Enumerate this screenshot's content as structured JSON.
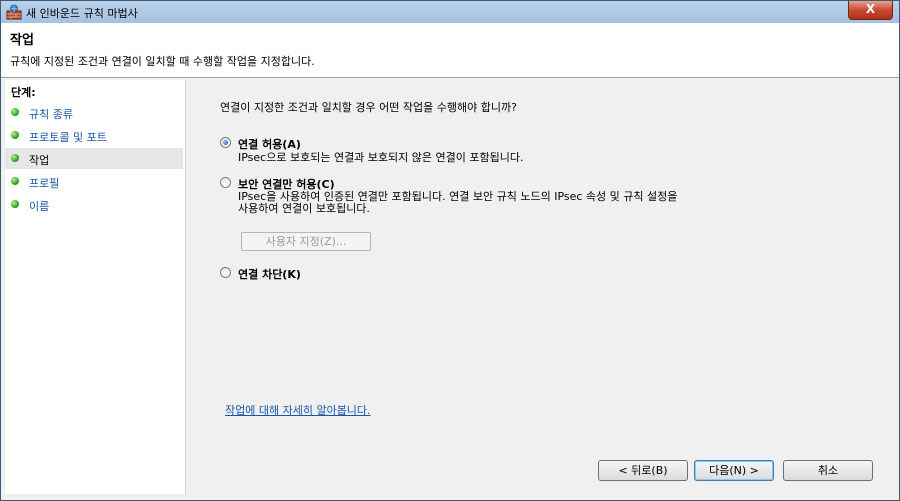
{
  "window": {
    "title": "새 인바운드 규칙 마법사",
    "close_label": "X"
  },
  "header": {
    "title": "작업",
    "description": "규칙에 지정된 조건과 연결이 일치할 때 수행할 작업을 지정합니다."
  },
  "sidebar": {
    "steps_label": "단계:",
    "items": [
      {
        "label": "규칙 종류"
      },
      {
        "label": "프로토콜 및 포트"
      },
      {
        "label": "작업"
      },
      {
        "label": "프로필"
      },
      {
        "label": "이름"
      }
    ],
    "current_index": 2
  },
  "main": {
    "question": "연결이 지정한 조건과 일치할 경우 어떤 작업을 수행해야 합니까?",
    "options": [
      {
        "label": "연결 허용(A)",
        "desc": "IPsec으로 보호되는 연결과 보호되지 않은 연결이 포함됩니다.",
        "checked": true
      },
      {
        "label": "보안 연결만 허용(C)",
        "desc_line1": "IPsec을 사용하여 인증된 연결만 포함됩니다. 연결 보안 규칙 노드의 IPsec 속성 및 규칙 설정을",
        "desc_line2": "사용하여 연결이 보호됩니다.",
        "checked": false
      },
      {
        "label": "연결 차단(K)",
        "checked": false
      }
    ],
    "custom_button": "사용자 지정(Z)...",
    "learn_link": "작업에 대해 자세히 알아봅니다."
  },
  "footer": {
    "back": "< 뒤로(B)",
    "next": "다음(N) >",
    "cancel": "취소"
  }
}
